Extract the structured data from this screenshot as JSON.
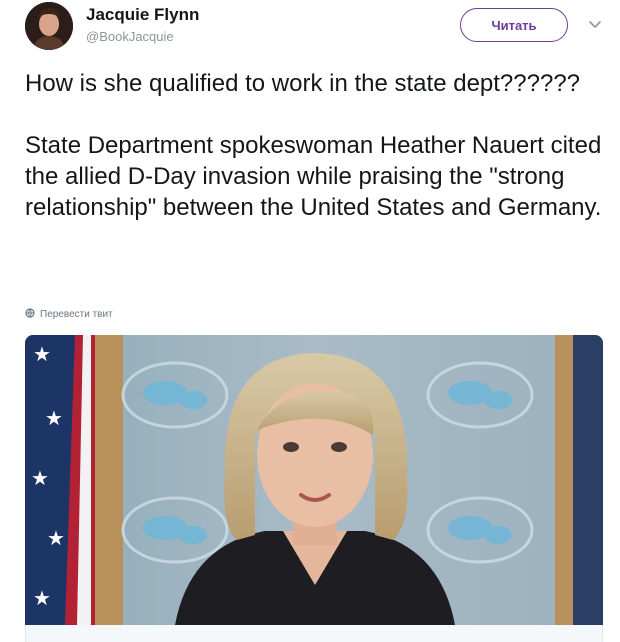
{
  "author": {
    "name": "Jacquie Flynn",
    "handle": "@BookJacquie"
  },
  "follow_label": "Читать",
  "tweet_text": "How is she qualified to work in the state dept??????\n\nState Department spokeswoman Heather Nauert cited the allied D-Day invasion while praising the \"strong relationship\" between the United States and Germany.",
  "translate_label": "Перевести твит",
  "icons": {
    "menu": "chevron-down-icon",
    "translate": "globe-icon"
  },
  "colors": {
    "accent": "#6b3d9a",
    "text": "#14171a",
    "muted": "#8b969e"
  }
}
